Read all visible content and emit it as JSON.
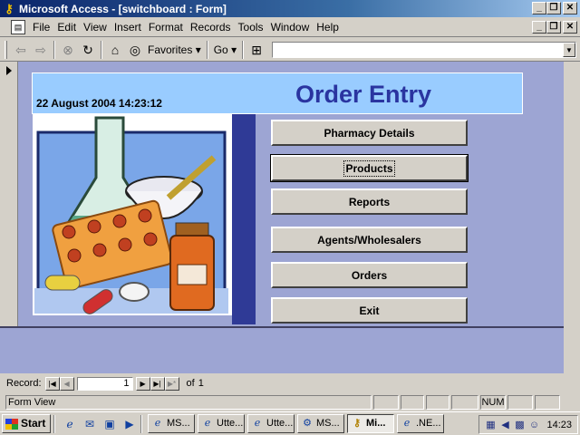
{
  "window": {
    "title": "Microsoft Access - [switchboard : Form]"
  },
  "menubar": {
    "items": [
      "File",
      "Edit",
      "View",
      "Insert",
      "Format",
      "Records",
      "Tools",
      "Window",
      "Help"
    ]
  },
  "toolbar": {
    "favorites_label": "Favorites",
    "go_label": "Go",
    "address_value": ""
  },
  "form": {
    "title": "Order Entry",
    "timestamp": "22 August 2004 14:23:12",
    "buttons": [
      {
        "label": "Pharmacy Details"
      },
      {
        "label": "Products"
      },
      {
        "label": "Reports"
      },
      {
        "label": "Agents/Wholesalers"
      },
      {
        "label": "Orders"
      },
      {
        "label": "Exit"
      }
    ]
  },
  "record_nav": {
    "label": "Record:",
    "current": "1",
    "of_label": "of",
    "total": "1"
  },
  "statusbar": {
    "text": "Form View",
    "num_indicator": "NUM"
  },
  "taskbar": {
    "start_label": "Start",
    "tasks": [
      {
        "label": "MS...",
        "icon": "ie-icon"
      },
      {
        "label": "Utte...",
        "icon": "ie-icon"
      },
      {
        "label": "Utte...",
        "icon": "ie-icon"
      },
      {
        "label": "MS...",
        "icon": "mmc-icon"
      },
      {
        "label": "Mi...",
        "icon": "access-key-icon"
      },
      {
        "label": ".NE...",
        "icon": "ie-icon"
      }
    ],
    "clock": "14:23"
  },
  "colors": {
    "title_text": "#2a34a0",
    "header_panel": "#99ccff",
    "form_bg": "#9da5d3",
    "strip": "#2f3a96"
  }
}
